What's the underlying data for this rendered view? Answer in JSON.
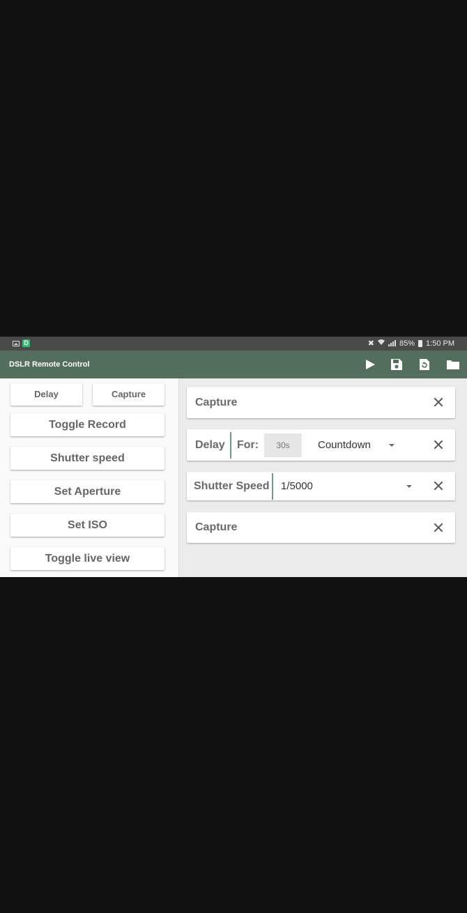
{
  "status_bar": {
    "icons_left": [
      "gallery-icon",
      "d-app-icon"
    ],
    "d_badge": "D",
    "battery": "85%",
    "time": "1:50 PM",
    "icons_right": [
      "mute-icon",
      "wifi-icon",
      "signal-icon",
      "battery-icon"
    ]
  },
  "app_bar": {
    "title": "DSLR Remote Control",
    "actions": [
      "play-icon",
      "save-icon",
      "restore-icon",
      "folder-icon"
    ]
  },
  "left_panel": {
    "delay_label": "Delay",
    "capture_label": "Capture",
    "toggle_record_label": "Toggle Record",
    "shutter_speed_label": "Shutter speed",
    "set_aperture_label": "Set Aperture",
    "set_iso_label": "Set ISO",
    "toggle_live_view_label": "Toggle live view"
  },
  "sequence": {
    "capture_1": {
      "label": "Capture"
    },
    "delay": {
      "label": "Delay",
      "for_label": "For:",
      "duration_value": "30s",
      "mode_value": "Countdown"
    },
    "shutter_speed": {
      "label": "Shutter Speed",
      "value": "1/5000"
    },
    "capture_2": {
      "label": "Capture"
    }
  },
  "colors": {
    "app_bar": "#546e5e",
    "accent_divider": "#6e9a84",
    "status_bar": "#4a4a4a",
    "background_outer": "#111111"
  }
}
